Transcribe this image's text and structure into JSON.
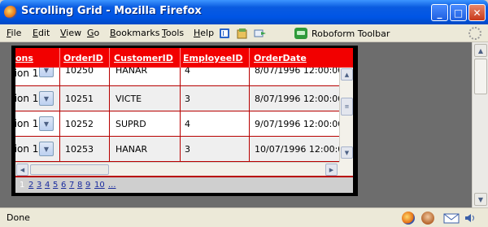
{
  "window": {
    "title": "Scrolling Grid - Mozilla Firefox"
  },
  "menu": {
    "items": [
      {
        "key": "F",
        "rest": "ile"
      },
      {
        "key": "E",
        "rest": "dit"
      },
      {
        "key": "V",
        "rest": "iew"
      },
      {
        "key": "G",
        "rest": "o"
      },
      {
        "key": "B",
        "rest": "ookmarks"
      },
      {
        "key": "T",
        "rest": "ools"
      },
      {
        "key": "H",
        "rest": "elp"
      }
    ],
    "roboform_label": "Roboform Toolbar"
  },
  "grid": {
    "headers": [
      "ons",
      "OrderID",
      "CustomerID",
      "EmployeeID",
      "OrderDate"
    ],
    "select_text": "tion 1",
    "rows": [
      {
        "order_id": "10250",
        "customer_id": "HANAR",
        "employee_id": "4",
        "order_date": "8/07/1996 12:00:00"
      },
      {
        "order_id": "10251",
        "customer_id": "VICTE",
        "employee_id": "3",
        "order_date": "8/07/1996 12:00:00"
      },
      {
        "order_id": "10252",
        "customer_id": "SUPRD",
        "employee_id": "4",
        "order_date": "9/07/1996 12:00:00"
      },
      {
        "order_id": "10253",
        "customer_id": "HANAR",
        "employee_id": "3",
        "order_date": "10/07/1996 12:00:0"
      }
    ],
    "pager": {
      "current": "1",
      "pages": [
        "2",
        "3",
        "4",
        "5",
        "6",
        "7",
        "8",
        "9",
        "10",
        "..."
      ]
    }
  },
  "status": {
    "text": "Done"
  },
  "colors": {
    "header": "#f20000",
    "grid_border": "#b80000",
    "frame": "#000000",
    "page_bg": "#6d6d6d"
  }
}
